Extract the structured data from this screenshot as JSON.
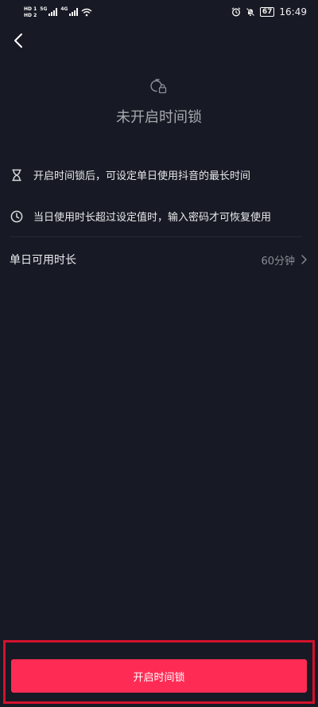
{
  "status_bar": {
    "sim1": "HD 1",
    "sim2": "HD 2",
    "net1": "5G",
    "net2": "4G",
    "battery": "67",
    "time": "16:49"
  },
  "header": {
    "back_icon": "chevron-left-icon"
  },
  "hero": {
    "icon": "timer-lock-icon",
    "title": "未开启时间锁"
  },
  "info": [
    {
      "icon": "hourglass-icon",
      "text": "开启时间锁后，可设定单日使用抖音的最长时间"
    },
    {
      "icon": "clock-icon",
      "text": "当日使用时长超过设定值时，输入密码才可恢复使用"
    }
  ],
  "setting": {
    "label": "单日可用时长",
    "value": "60分钟",
    "icon": "chevron-right-icon"
  },
  "action": {
    "button_label": "开启时间锁"
  },
  "colors": {
    "background": "#171a24",
    "accent": "#fe2c55",
    "highlight_frame": "#d4122d"
  }
}
